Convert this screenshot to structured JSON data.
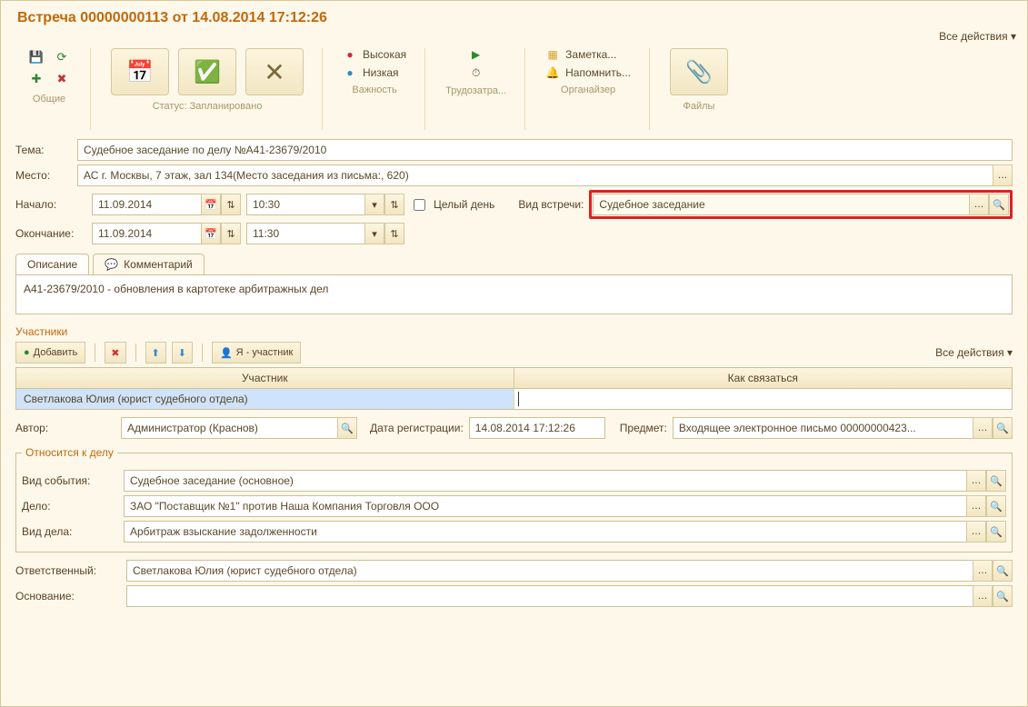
{
  "header": {
    "title": "Встреча 00000000113 от 14.08.2014 17:12:26",
    "all_actions": "Все действия"
  },
  "ribbon": {
    "general_label": "Общие",
    "status_label": "Статус: Запланировано",
    "importance_label": "Важность",
    "importance_high": "Высокая",
    "importance_low": "Низкая",
    "effort_label": "Трудозатра...",
    "organizer_label": "Органайзер",
    "organizer_note": "Заметка...",
    "organizer_remind": "Напомнить...",
    "files_label": "Файлы"
  },
  "form": {
    "theme_label": "Тема:",
    "theme_value": "Судебное заседание по делу №А41-23679/2010",
    "place_label": "Место:",
    "place_value": "АС г. Москвы, 7 этаж, зал 134(Место заседания из письма:, 620)",
    "start_label": "Начало:",
    "start_date": "11.09.2014",
    "start_time": "10:30",
    "end_label": "Окончание:",
    "end_date": "11.09.2014",
    "end_time": "11:30",
    "allday_label": "Целый день",
    "meetingtype_label": "Вид встречи:",
    "meetingtype_value": "Судебное заседание"
  },
  "tabs": {
    "description": "Описание",
    "comment": "Комментарий"
  },
  "description_text": "А41-23679/2010 - обновления в картотеке арбитражных дел",
  "participants": {
    "title": "Участники",
    "add": "Добавить",
    "iam": "Я - участник",
    "all_actions": "Все действия",
    "col_participant": "Участник",
    "col_contact": "Как связаться",
    "row1_name": "Светлакова Юлия (юрист судебного отдела)",
    "row1_contact": ""
  },
  "meta": {
    "author_label": "Автор:",
    "author_value": "Администратор (Краснов)",
    "regdate_label": "Дата регистрации:",
    "regdate_value": "14.08.2014 17:12:26",
    "subject_label": "Предмет:",
    "subject_value": "Входящее электронное письмо 00000000423..."
  },
  "case": {
    "legend": "Относится к делу",
    "eventtype_label": "Вид события:",
    "eventtype_value": "Судебное заседание (основное)",
    "case_label": "Дело:",
    "case_value": "ЗАО \"Поставщик №1\" против Наша Компания Торговля ООО",
    "casetype_label": "Вид дела:",
    "casetype_value": "Арбитраж взыскание задолженности"
  },
  "footer": {
    "responsible_label": "Ответственный:",
    "responsible_value": "Светлакова Юлия (юрист судебного отдела)",
    "basis_label": "Основание:",
    "basis_value": ""
  }
}
